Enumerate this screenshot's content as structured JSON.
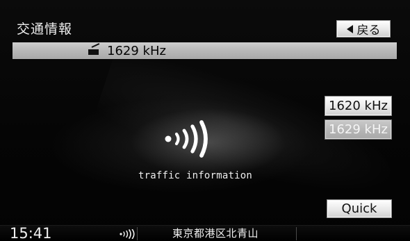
{
  "header": {
    "title": "交通情報",
    "back_label": "戻る"
  },
  "tuner": {
    "current_frequency": "1629 kHz"
  },
  "presets": [
    {
      "label": "1620 kHz",
      "selected": false
    },
    {
      "label": "1629 kHz",
      "selected": true
    }
  ],
  "quick_button": {
    "label": "Quick"
  },
  "center": {
    "label": "traffic information"
  },
  "status_bar": {
    "time": "15:41",
    "location": "東京都港区北青山"
  },
  "icons": {
    "back": "left-triangle-icon",
    "radio": "radio-icon",
    "traffic": "traffic-broadcast-icon"
  },
  "colors": {
    "background": "#000000",
    "frequency_bar": "#bdbdbd",
    "button": "#e7e7e7",
    "selected_button": "#b5b5b5",
    "text_light": "#ededed",
    "text_dark": "#111111"
  }
}
